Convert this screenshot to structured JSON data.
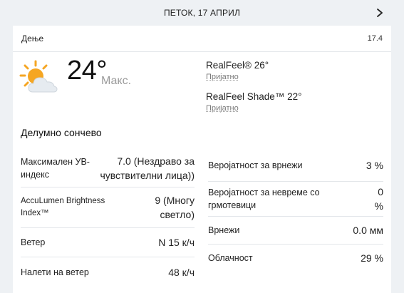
{
  "header": {
    "date": "ПЕТОК, 17 АПРИЛ"
  },
  "section": {
    "title": "Дење",
    "time": "17.4"
  },
  "current": {
    "icon": "partly-sunny-icon",
    "temp": "24°",
    "temp_label": "Макс.",
    "realfeel": "RealFeel® 26°",
    "realfeel_desc": "Пријатно",
    "realfeel_shade": "RealFeel Shade™ 22°",
    "realfeel_shade_desc": "Пријатно",
    "phrase": "Делумно сончево"
  },
  "left_details": [
    {
      "label": "Максимален УВ-индекс",
      "value": "7.0 (Нездраво за чувствителни лица))"
    },
    {
      "label": "AccuLumen Brightness Index™",
      "value": "9 (Многу светло)"
    },
    {
      "label": "Ветер",
      "value": "N 15 к/ч"
    },
    {
      "label": "Налети на ветер",
      "value": "48 к/ч"
    }
  ],
  "right_details": [
    {
      "label": "Веројатност за врнежи",
      "value": "3 %"
    },
    {
      "label": "Веројатност за невреме со грмотевици",
      "value": "0 %"
    },
    {
      "label": "Врнежи",
      "value": "0.0 мм"
    },
    {
      "label": "Облачност",
      "value": "29 %"
    }
  ],
  "colors": {
    "sun": "#f5a623",
    "cloud": "#e6ebf0",
    "divider": "#e3e6ea",
    "background": "#eef1f4"
  }
}
